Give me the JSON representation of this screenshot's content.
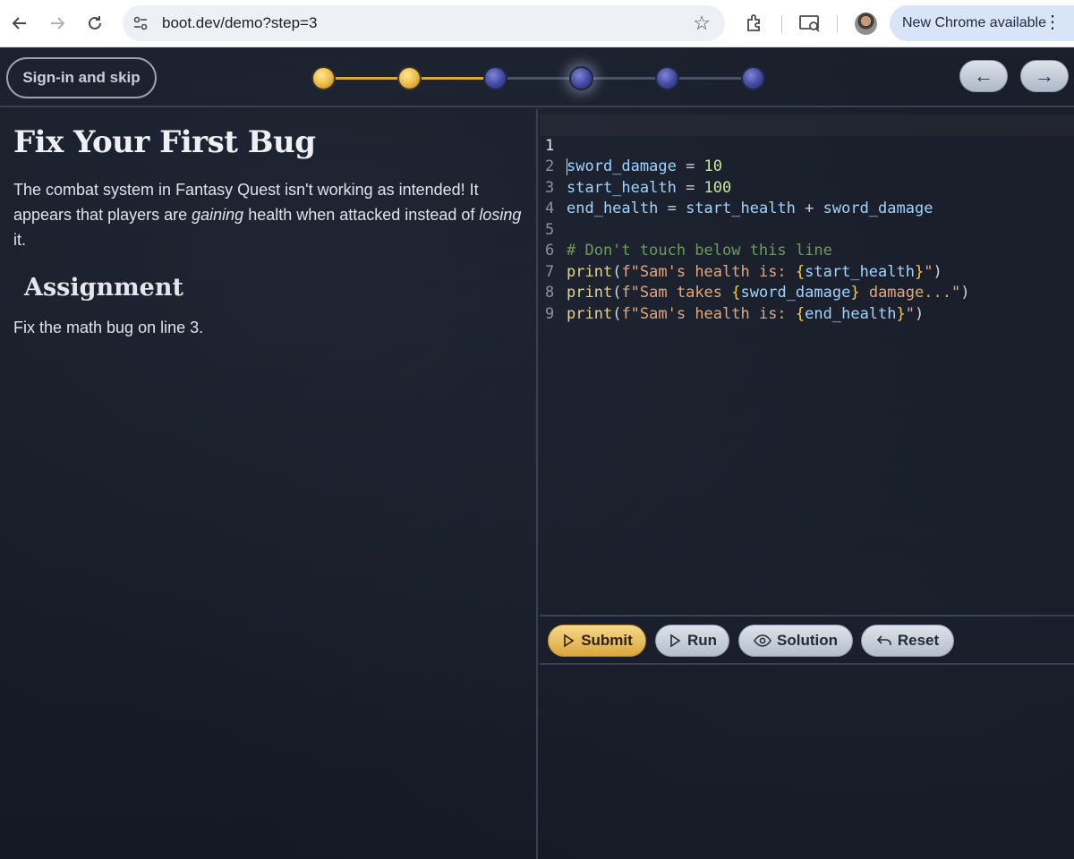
{
  "browser": {
    "url": "boot.dev/demo?step=3",
    "update_label": "New Chrome available",
    "icons": [
      "back-arrow-icon",
      "forward-arrow-icon",
      "reload-icon",
      "site-settings-icon",
      "star-icon",
      "extensions-icon",
      "cast-icon",
      "profile-avatar",
      "more-icon"
    ]
  },
  "header": {
    "signin_label": "Sign-in and skip",
    "prev_arrow": "←",
    "next_arrow": "→",
    "steps": [
      {
        "state": "done"
      },
      {
        "state": "done"
      },
      {
        "state": "upcoming"
      },
      {
        "state": "current"
      },
      {
        "state": "upcoming"
      },
      {
        "state": "upcoming"
      }
    ]
  },
  "lesson": {
    "title": "Fix Your First Bug",
    "paragraph_part1": "The combat system in Fantasy Quest isn't working as intended! It appears that players are ",
    "paragraph_em1": "gaining",
    "paragraph_part2": " health when attacked instead of ",
    "paragraph_em2": "losing",
    "paragraph_part3": " it.",
    "subtitle": "Assignment",
    "task": "Fix the math bug on line 3."
  },
  "editor": {
    "line_numbers": [
      "1",
      "2",
      "3",
      "4",
      "5",
      "6",
      "7",
      "8",
      "9"
    ],
    "lines": [
      "sword_damage = 10",
      "start_health = 100",
      "end_health = start_health + sword_damage",
      "",
      "# Don't touch below this line",
      "print(f\"Sam's health is: {start_health}\")",
      "print(f\"Sam takes {sword_damage} damage...\")",
      "print(f\"Sam's health is: {end_health}\")",
      ""
    ],
    "active_line": 1
  },
  "toolbar": {
    "submit_label": "Submit",
    "run_label": "Run",
    "solution_label": "Solution",
    "reset_label": "Reset"
  },
  "colors": {
    "accent_gold": "#d9a73c",
    "step_blue": "#3f47a0",
    "background": "#171b26"
  }
}
